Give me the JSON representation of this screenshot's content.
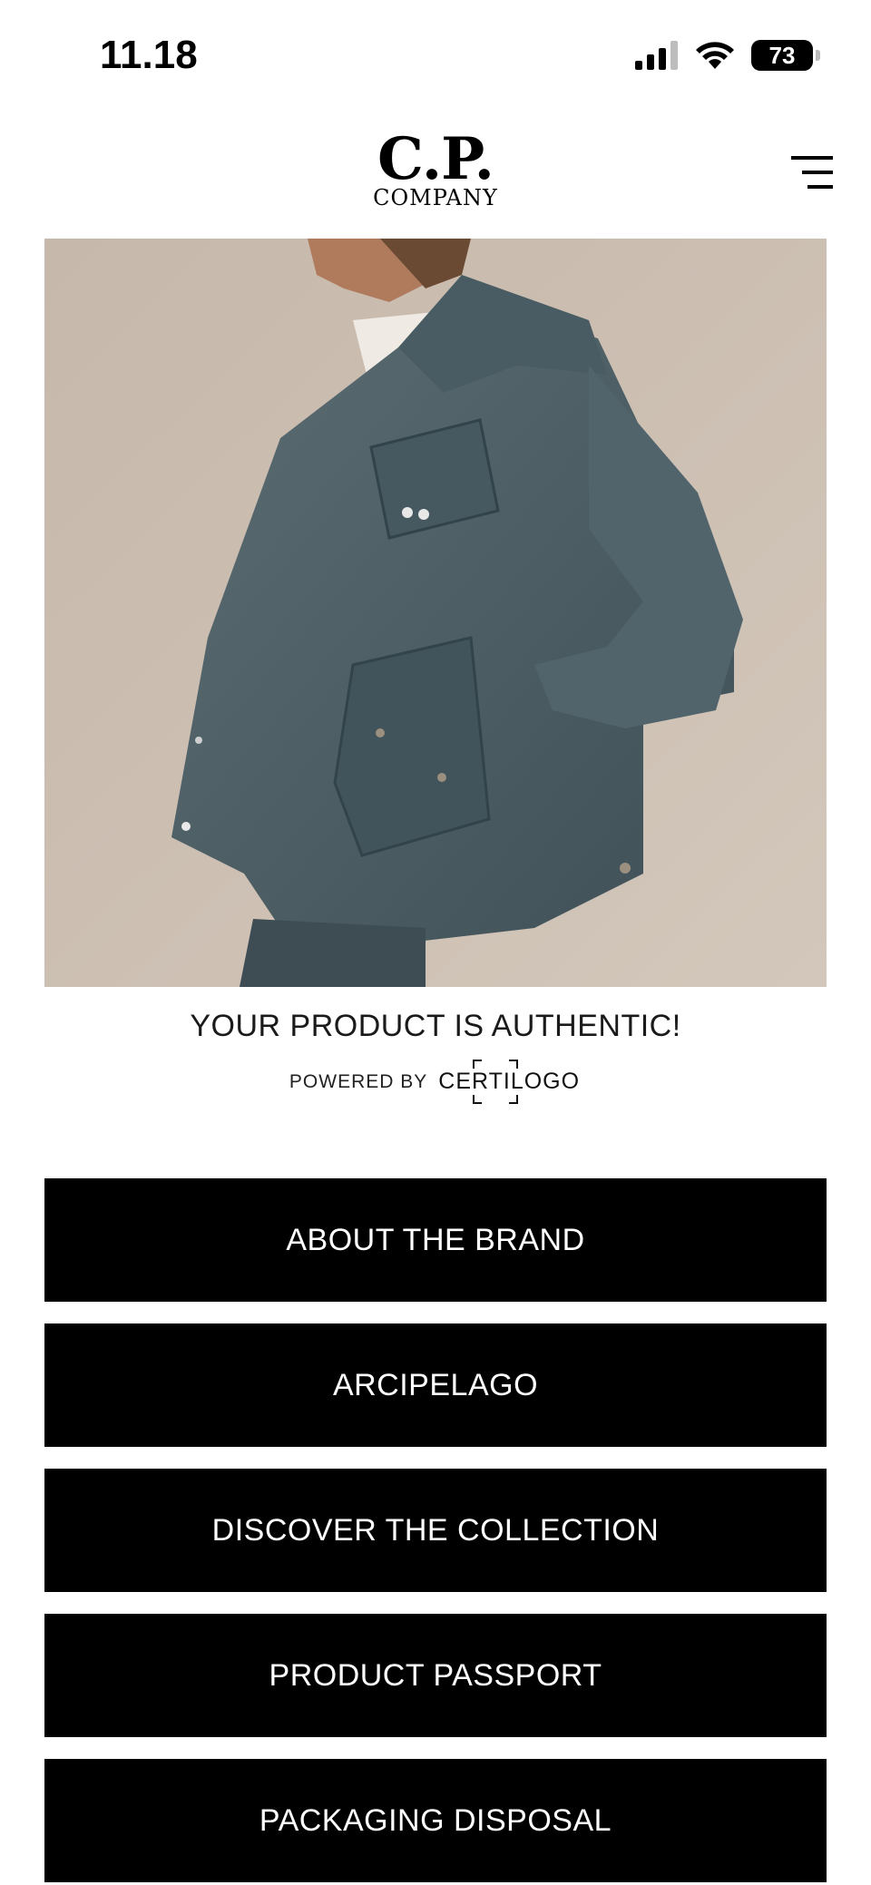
{
  "status_bar": {
    "time": "11.18",
    "battery": "73"
  },
  "header": {
    "logo_main": "C.P.",
    "logo_sub": "COMPANY"
  },
  "auth": {
    "title": "YOUR PRODUCT IS AUTHENTIC!",
    "powered_by": "POWERED BY",
    "provider": "CERTILOGO"
  },
  "buttons": [
    {
      "label": "ABOUT THE BRAND"
    },
    {
      "label": "ARCIPELAGO"
    },
    {
      "label": "DISCOVER THE COLLECTION"
    },
    {
      "label": "PRODUCT PASSPORT"
    },
    {
      "label": "PACKAGING DISPOSAL"
    }
  ],
  "icons": {
    "signal": "cellular-signal-icon",
    "wifi": "wifi-icon",
    "battery": "battery-icon",
    "menu": "hamburger-menu-icon"
  },
  "colors": {
    "button_bg": "#000000",
    "button_text": "#ffffff",
    "photo_backdrop": "#cbbfb3",
    "jacket": "#4e5f66"
  }
}
